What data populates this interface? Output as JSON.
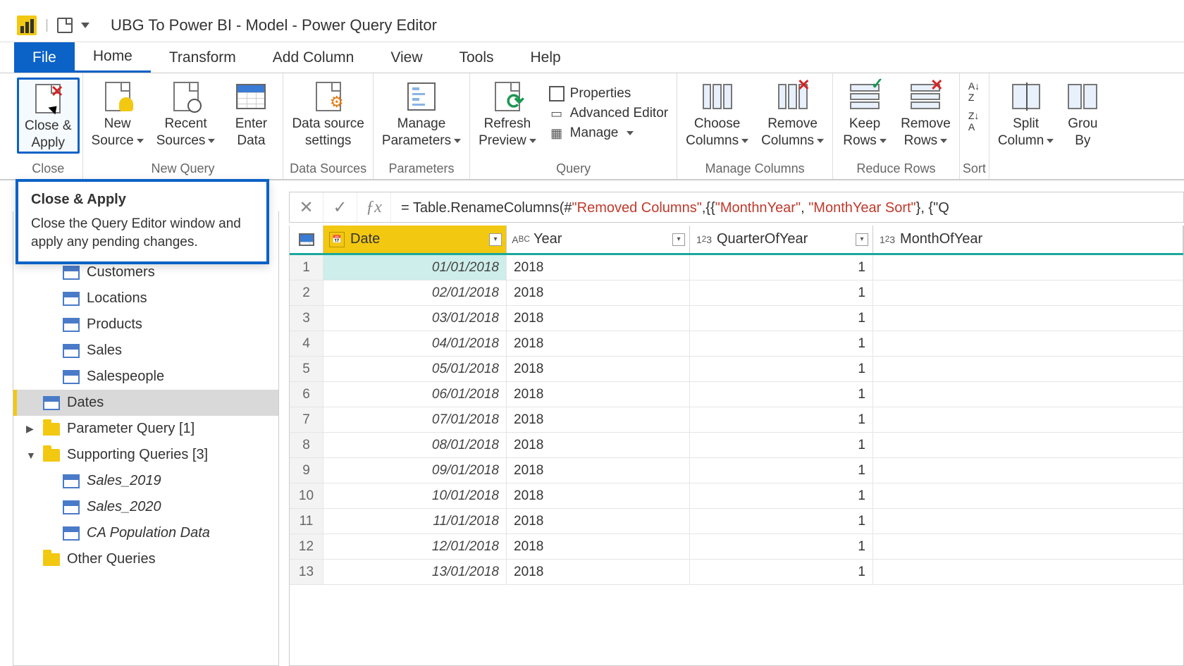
{
  "window": {
    "title": "UBG To Power BI - Model - Power Query Editor"
  },
  "tabs": {
    "file": "File",
    "home": "Home",
    "transform": "Transform",
    "addcol": "Add Column",
    "view": "View",
    "tools": "Tools",
    "help": "Help"
  },
  "ribbon": {
    "close_group": "Close",
    "close_apply": "Close &\nApply",
    "new_query_group": "New Query",
    "new_source": "New\nSource",
    "recent_sources": "Recent\nSources",
    "enter_data": "Enter\nData",
    "data_sources_group": "Data Sources",
    "ds_settings": "Data source\nsettings",
    "parameters_group": "Parameters",
    "manage_params": "Manage\nParameters",
    "query_group": "Query",
    "refresh_preview": "Refresh\nPreview",
    "properties": "Properties",
    "advanced_editor": "Advanced Editor",
    "manage": "Manage",
    "manage_cols_group": "Manage Columns",
    "choose_cols": "Choose\nColumns",
    "remove_cols": "Remove\nColumns",
    "reduce_rows_group": "Reduce Rows",
    "keep_rows": "Keep\nRows",
    "remove_rows": "Remove\nRows",
    "sort_group": "Sort",
    "split_col": "Split\nColumn",
    "group_by": "Grou\nBy"
  },
  "tooltip": {
    "title": "Close & Apply",
    "body": "Close the Query Editor window and apply any pending changes."
  },
  "queries": {
    "customers": "Customers",
    "locations": "Locations",
    "products": "Products",
    "sales": "Sales",
    "salespeople": "Salespeople",
    "dates": "Dates",
    "param_folder": "Parameter Query [1]",
    "support_folder": "Supporting Queries [3]",
    "sales2019": "Sales_2019",
    "sales2020": "Sales_2020",
    "ca_pop": "CA Population Data",
    "other_folder": "Other Queries"
  },
  "formula": {
    "prefix": "= Table.RenameColumns(#",
    "s1": "\"Removed Columns\"",
    "mid": ",{{",
    "s2": "\"MonthnYear\"",
    "c1": ", ",
    "s3": "\"MonthYear Sort\"",
    "tail": "}, {\"Q"
  },
  "columns": {
    "date": "Date",
    "year": "Year",
    "qoy": "QuarterOfYear",
    "moy": "MonthOfYear"
  },
  "rows": [
    {
      "n": "1",
      "date": "01/01/2018",
      "year": "2018",
      "qoy": "1"
    },
    {
      "n": "2",
      "date": "02/01/2018",
      "year": "2018",
      "qoy": "1"
    },
    {
      "n": "3",
      "date": "03/01/2018",
      "year": "2018",
      "qoy": "1"
    },
    {
      "n": "4",
      "date": "04/01/2018",
      "year": "2018",
      "qoy": "1"
    },
    {
      "n": "5",
      "date": "05/01/2018",
      "year": "2018",
      "qoy": "1"
    },
    {
      "n": "6",
      "date": "06/01/2018",
      "year": "2018",
      "qoy": "1"
    },
    {
      "n": "7",
      "date": "07/01/2018",
      "year": "2018",
      "qoy": "1"
    },
    {
      "n": "8",
      "date": "08/01/2018",
      "year": "2018",
      "qoy": "1"
    },
    {
      "n": "9",
      "date": "09/01/2018",
      "year": "2018",
      "qoy": "1"
    },
    {
      "n": "10",
      "date": "10/01/2018",
      "year": "2018",
      "qoy": "1"
    },
    {
      "n": "11",
      "date": "11/01/2018",
      "year": "2018",
      "qoy": "1"
    },
    {
      "n": "12",
      "date": "12/01/2018",
      "year": "2018",
      "qoy": "1"
    },
    {
      "n": "13",
      "date": "13/01/2018",
      "year": "2018",
      "qoy": "1"
    }
  ]
}
